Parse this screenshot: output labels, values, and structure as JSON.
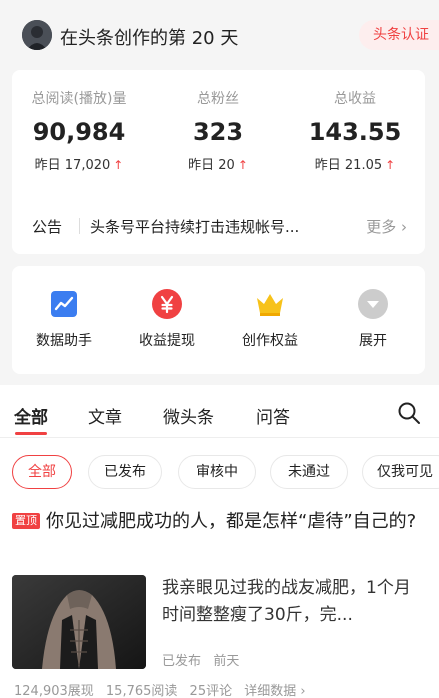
{
  "header": {
    "day_text": "在头条创作的第 20 天",
    "verify_label": "头条认证"
  },
  "stats": [
    {
      "label": "总阅读(播放)量",
      "value": "90,984",
      "yesterday": "昨日 17,020",
      "trend": "↑"
    },
    {
      "label": "总粉丝",
      "value": "323",
      "yesterday": "昨日 20",
      "trend": "↑"
    },
    {
      "label": "总收益",
      "value": "143.55",
      "yesterday": "昨日 21.05",
      "trend": "↑"
    }
  ],
  "notice": {
    "label": "公告",
    "text": "头条号平台持续打击违规帐号...",
    "more": "更多 ›"
  },
  "tools": [
    {
      "label": "数据助手",
      "icon": "chart-icon",
      "color": "#3b7df0"
    },
    {
      "label": "收益提现",
      "icon": "yen-icon",
      "color": "#f04142"
    },
    {
      "label": "创作权益",
      "icon": "crown-icon",
      "color": "#f7c21a"
    },
    {
      "label": "展开",
      "icon": "chevron-down-icon",
      "color": "#cccccc"
    }
  ],
  "tabs": [
    "全部",
    "文章",
    "微头条",
    "问答"
  ],
  "filters": [
    "全部",
    "已发布",
    "审核中",
    "未通过",
    "仅我可见"
  ],
  "article": {
    "pin": "置顶",
    "title": "你见过减肥成功的人，都是怎样“虐待”自己的?",
    "summary": "我亲眼见过我的战友减肥，1个月时间整整瘦了30斤，完...",
    "status": "已发布",
    "time": "前天",
    "impressions": "124,903展现",
    "reads": "15,765阅读",
    "comments": "25评论",
    "details": "详细数据 ›"
  },
  "colors": {
    "accent": "#f04142"
  }
}
